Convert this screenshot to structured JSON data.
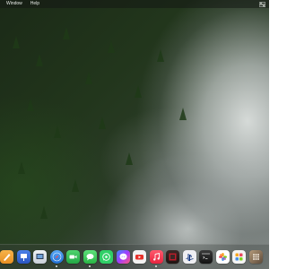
{
  "menubar": {
    "items": [
      {
        "label": "Window"
      },
      {
        "label": "Help"
      }
    ]
  },
  "dock": {
    "apps": [
      {
        "name": "pages-icon",
        "color": "#f2a33a"
      },
      {
        "name": "keynote-icon",
        "color": "#3f6fd8"
      },
      {
        "name": "preview-icon",
        "color": "#d9dee5"
      },
      {
        "name": "safari-icon",
        "color": "#2f8ee8"
      },
      {
        "name": "facetime-icon",
        "color": "#34c759"
      },
      {
        "name": "messages-icon",
        "color": "#3bd05a"
      },
      {
        "name": "whatsapp-icon",
        "color": "#25d366"
      },
      {
        "name": "messenger-icon",
        "color": "#5b63ff"
      },
      {
        "name": "youtube-icon",
        "color": "#e8312a"
      },
      {
        "name": "music-icon",
        "color": "#f53a55"
      },
      {
        "name": "photobooth-icon",
        "color": "#3a2a28"
      },
      {
        "name": "playstation-icon",
        "color": "#e6e6ea"
      },
      {
        "name": "terminal-icon",
        "color": "#1e1e1e"
      },
      {
        "name": "photos-icon",
        "color": "#f4f4f4"
      },
      {
        "name": "app-library-icon",
        "color": "#f2f2f2"
      },
      {
        "name": "launcher-icon",
        "color": "#7a6a58"
      }
    ]
  }
}
